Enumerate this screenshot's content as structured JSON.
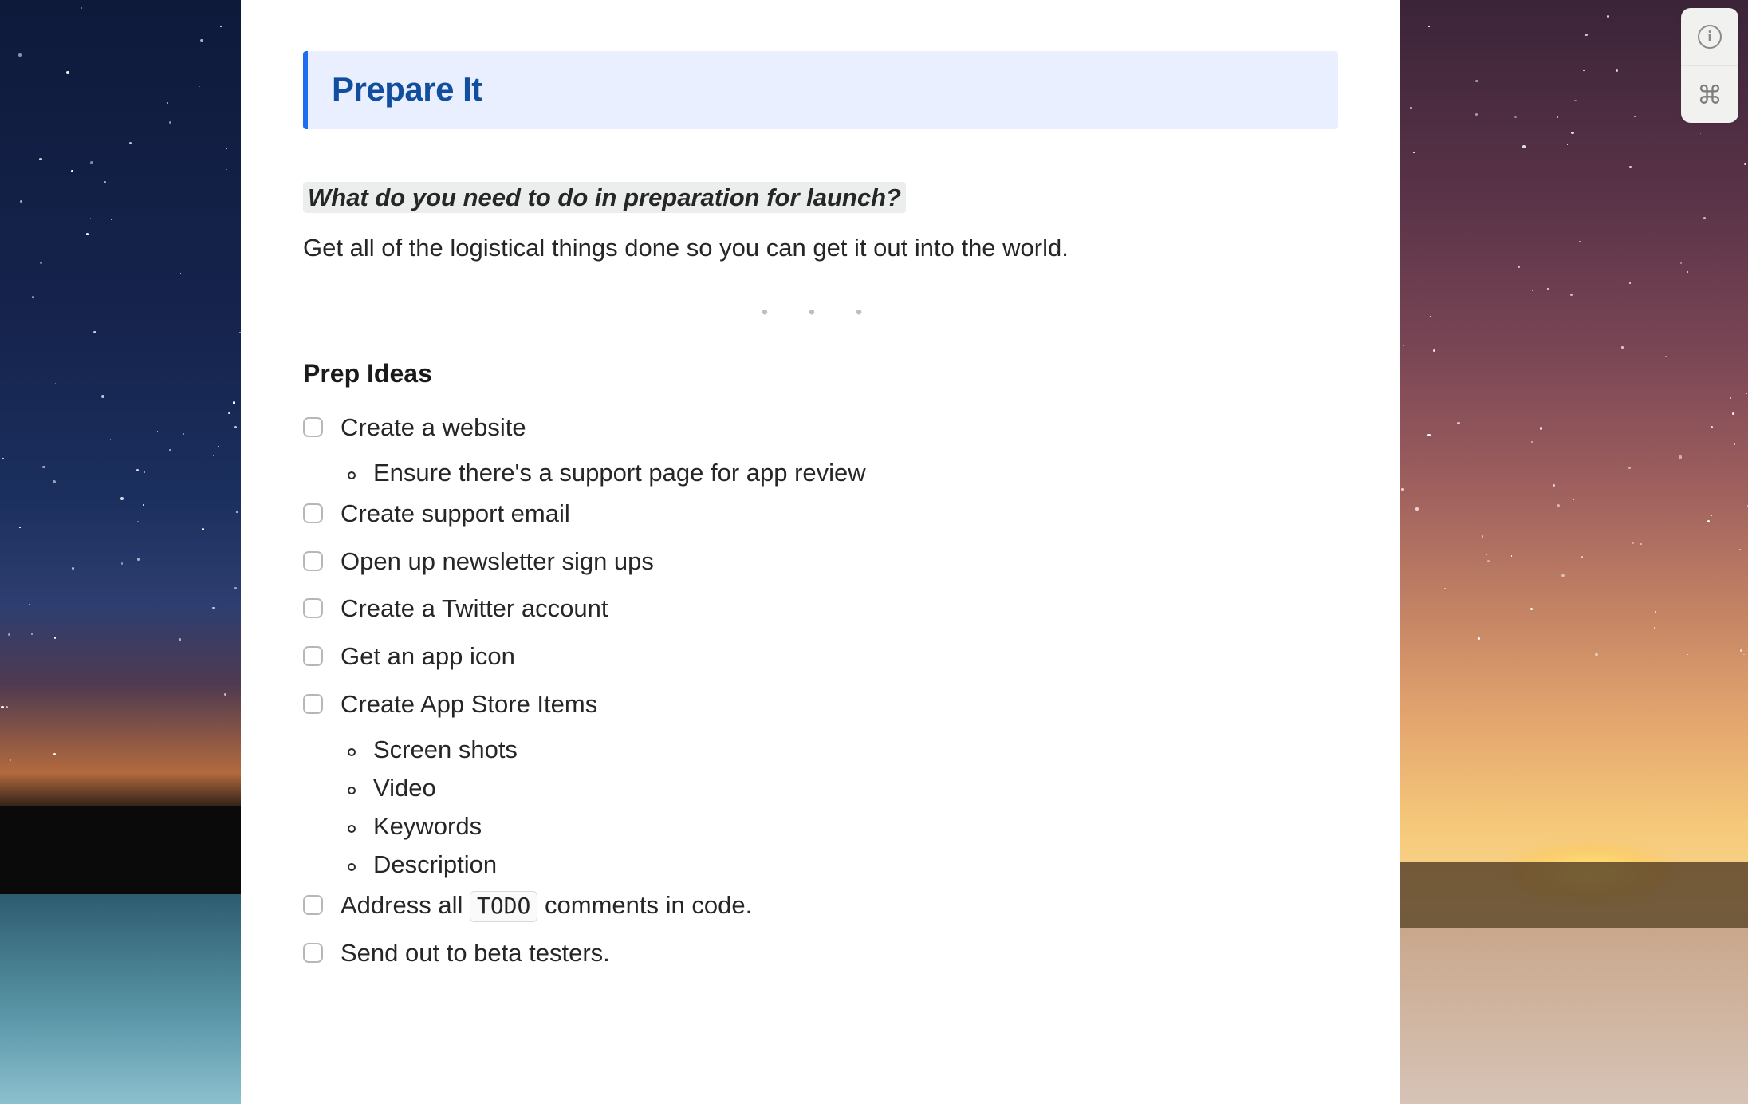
{
  "callout": {
    "title": "Prepare It"
  },
  "question": "What do you need to do in preparation for launch?",
  "subtitle": "Get all of the logistical things done so you can get it out into the world.",
  "dots": "•  •  •",
  "section_title": "Prep Ideas",
  "items": [
    {
      "label": "Create a website",
      "sub": [
        "Ensure there's a support page for app review"
      ]
    },
    {
      "label": "Create support email"
    },
    {
      "label": "Open up newsletter sign ups"
    },
    {
      "label": "Create a Twitter account"
    },
    {
      "label": "Get an app icon"
    },
    {
      "label": "Create App Store Items",
      "sub": [
        "Screen shots",
        "Video",
        "Keywords",
        "Description"
      ]
    },
    {
      "label_pre": "Address all ",
      "code": "TODO",
      "label_post": " comments in code."
    },
    {
      "label": "Send out to beta testers."
    }
  ],
  "tools": {
    "info": "i",
    "cmd": "⌘"
  }
}
